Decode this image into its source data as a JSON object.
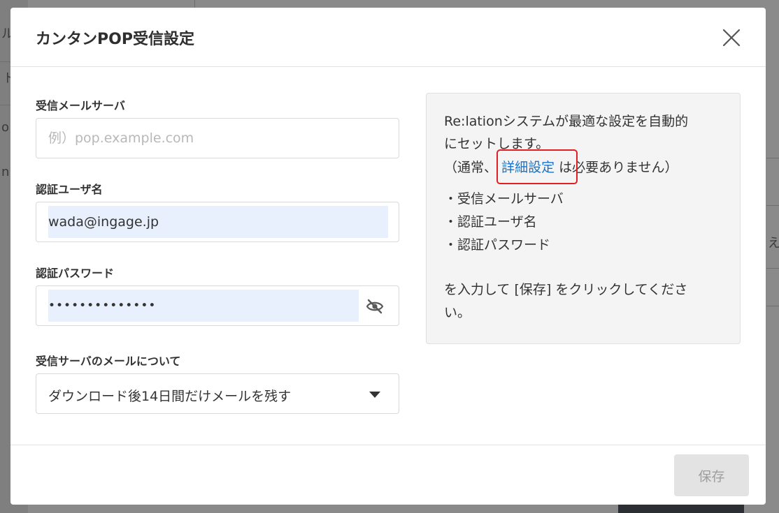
{
  "modal": {
    "title": "カンタンPOP受信設定",
    "close_label": "close"
  },
  "form": {
    "server": {
      "label": "受信メールサーバ",
      "placeholder": "例）pop.example.com",
      "value": ""
    },
    "username": {
      "label": "認証ユーザ名",
      "value": "wada@ingage.jp"
    },
    "password": {
      "label": "認証パスワード",
      "value": "••••••••••••••"
    },
    "retention": {
      "label": "受信サーバのメールについて",
      "selected": "ダウンロード後14日間だけメールを残す"
    }
  },
  "info": {
    "line1": "Re:lationシステムが最適な設定を自動的",
    "line2": "にセットします。",
    "line3_before": "（通常、",
    "line3_link": "詳細設定",
    "line3_after": "は必要ありません）",
    "bullets": [
      "・受信メールサーバ",
      "・認証ユーザ名",
      "・認証パスワード"
    ],
    "line_end1": "を入力して [保存] をクリックしてくださ",
    "line_end2": "い。"
  },
  "footer": {
    "save_label": "保存"
  },
  "background": {
    "chars": [
      "ル",
      "ト",
      "o",
      "n",
      "え"
    ]
  },
  "colors": {
    "accent_link": "#1a73c8",
    "highlight_red": "#e02020",
    "autofill_bg": "#e8f0fe",
    "disabled_button_bg": "#e3e3e3"
  },
  "icons": {
    "close": "close-icon",
    "eye": "eye-off-icon",
    "caret": "caret-down-icon"
  }
}
